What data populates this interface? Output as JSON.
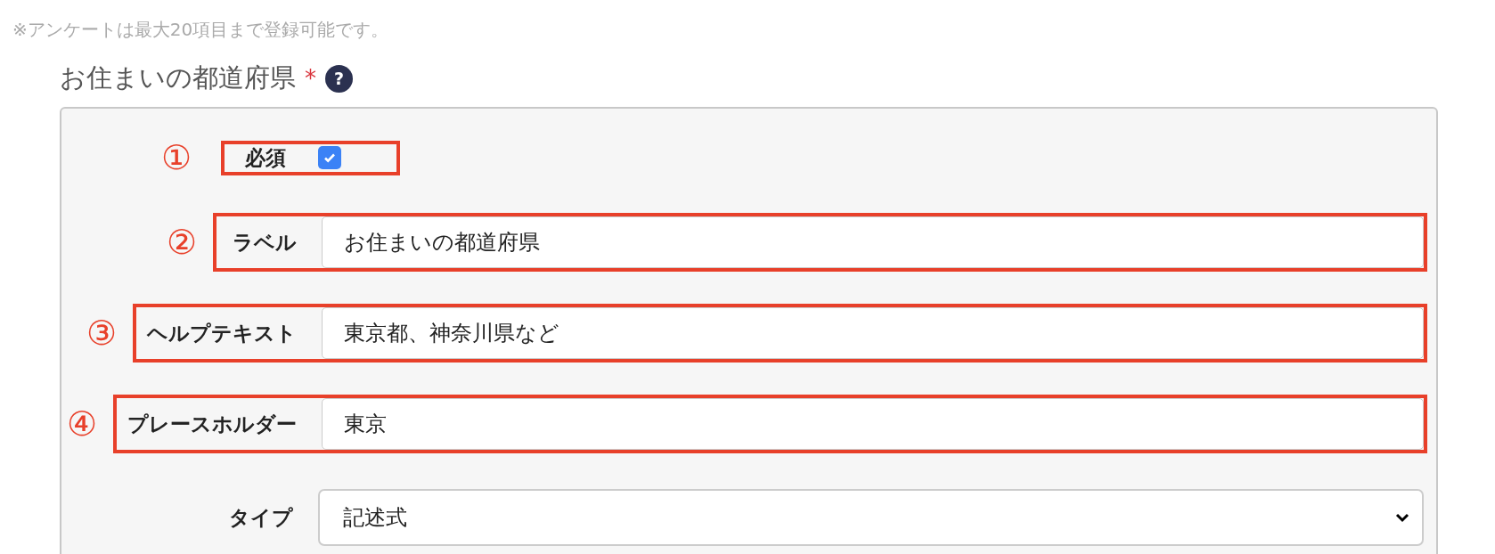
{
  "note": "※アンケートは最大20項目まで登録可能です。",
  "question": {
    "title": "お住まいの都道府県",
    "required_mark": "*",
    "help_icon": "?"
  },
  "rows": [
    {
      "kind": "checkbox",
      "marker": "①",
      "label": "必須",
      "checked": true
    },
    {
      "kind": "text",
      "marker": "②",
      "label": "ラベル",
      "value": "お住まいの都道府県"
    },
    {
      "kind": "text",
      "marker": "③",
      "label": "ヘルプテキスト",
      "value": "東京都、神奈川県など"
    },
    {
      "kind": "text",
      "marker": "④",
      "label": "プレースホルダー",
      "value": "東京"
    },
    {
      "kind": "select",
      "label": "タイプ",
      "value": "記述式"
    }
  ]
}
